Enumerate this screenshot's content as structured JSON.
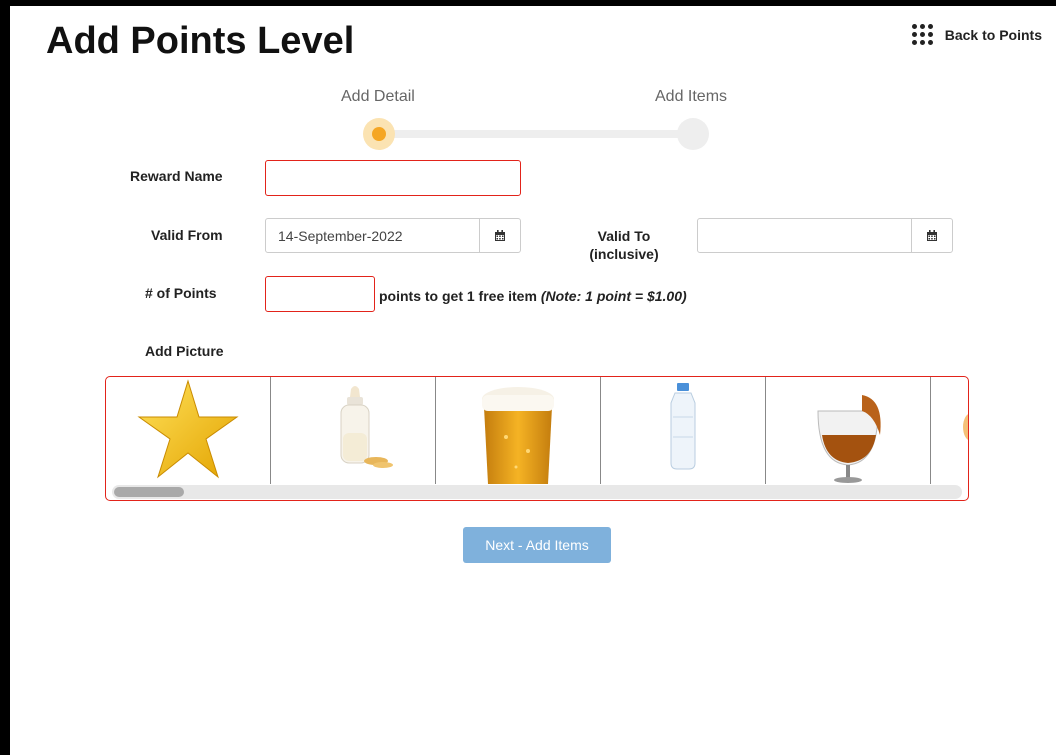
{
  "page": {
    "title": "Add Points Level"
  },
  "header": {
    "back_label": "Back to Points"
  },
  "steps": [
    {
      "label": "Add Detail",
      "active": true
    },
    {
      "label": "Add Items",
      "active": false
    }
  ],
  "form": {
    "reward_name": {
      "label": "Reward Name",
      "value": ""
    },
    "valid_from": {
      "label": "Valid From",
      "value": "14-September-2022"
    },
    "valid_to": {
      "label_line1": "Valid To",
      "label_line2": "(inclusive)",
      "value": ""
    },
    "points": {
      "label": "# of Points",
      "value": "",
      "note_text": "points to get 1 free item ",
      "note_italic": "(Note: 1 point = $1.00)"
    },
    "picture": {
      "label": "Add Picture"
    }
  },
  "gallery_items": [
    "star-icon",
    "baby-bottle-icon",
    "beer-glass-icon",
    "water-bottle-icon",
    "brandy-glass-icon",
    "partial-item-icon"
  ],
  "scroll_position": 0.0,
  "buttons": {
    "next_label": "Next - Add Items"
  },
  "colors": {
    "error_border": "#e2231a",
    "step_active": "#f5a623",
    "primary_button": "#7fb1dc"
  }
}
